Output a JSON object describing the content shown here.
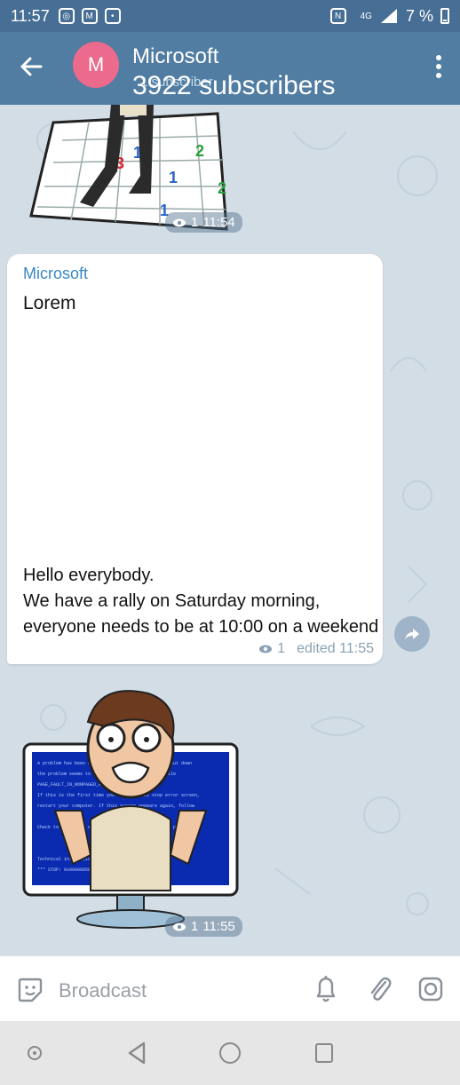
{
  "status_bar": {
    "time": "11:57",
    "network": "4G",
    "battery": "7 %",
    "icons": [
      "instagram-icon",
      "gmail-icon",
      "app-icon",
      "nfc-icon",
      "signal-icon",
      "battery-icon"
    ]
  },
  "header": {
    "title": "Microsoft",
    "subtitle_small": "1 subscriber",
    "subtitle_overlay": "3922 subscribers",
    "avatar_letter": "M",
    "avatar_color": "#ec6a8c"
  },
  "messages": [
    {
      "type": "sticker",
      "views": "1",
      "time": "11:54"
    },
    {
      "type": "text",
      "sender": "Microsoft",
      "title": "Lorem",
      "body_lines": [
        "Hello everybody.",
        "We have a rally on Saturday morning,",
        "everyone needs to be at 10:00 on a weekend"
      ],
      "views": "1",
      "edited_time": "edited 11:55"
    },
    {
      "type": "sticker",
      "views": "1",
      "time": "11:55"
    }
  ],
  "input": {
    "placeholder": "Broadcast"
  },
  "colors": {
    "header": "#517da2",
    "status": "#476e95",
    "sender": "#3a88c4",
    "background": "#d2dde6"
  }
}
